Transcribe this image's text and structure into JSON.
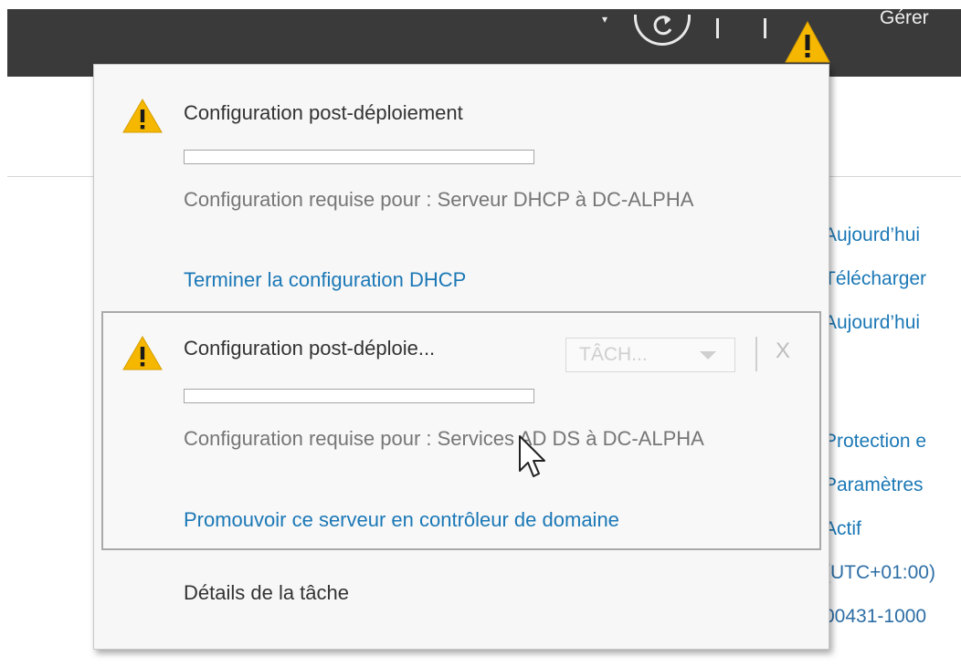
{
  "header": {
    "manage_label": "Gérer",
    "icons": [
      "chevron-down-icon",
      "refresh-icon",
      "warning-flag-icon"
    ]
  },
  "colors": {
    "header_bg": "#3a3a3a",
    "panel_bg": "#f7f7f7",
    "link": "#1b78b6",
    "warning": "#f5b700"
  },
  "background_properties": [
    "Aujourd’hui",
    "Télécharger",
    "Aujourd’hui",
    "Protection e",
    "Paramètres",
    "Actif",
    "(UTC+01:00)",
    "00431-1000"
  ],
  "notifications": [
    {
      "title": "Configuration post-déploiement",
      "progress": 0,
      "description": "Configuration requise pour : Serveur DHCP à DC-ALPHA",
      "link": "Terminer la configuration DHCP"
    },
    {
      "title": "Configuration post-déploie...",
      "progress": 0,
      "description": "Configuration requise pour : Services AD DS à DC-ALPHA",
      "link": "Promouvoir ce serveur en contrôleur de domaine",
      "tasks_label": "TÂCH...",
      "dismiss_label": "X"
    }
  ],
  "task_details_label": "Détails de la tâche"
}
